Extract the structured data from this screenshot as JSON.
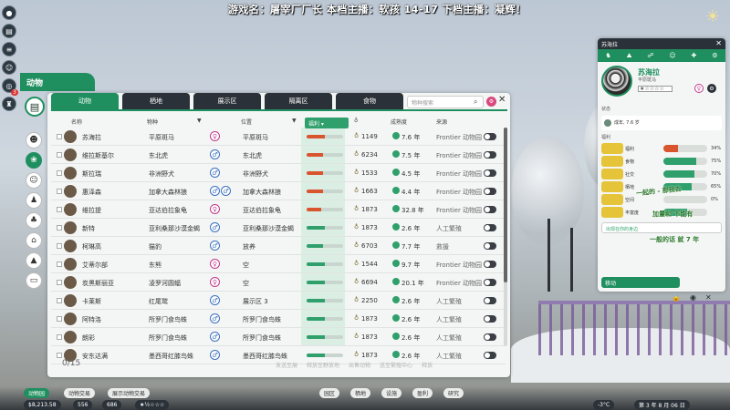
{
  "stream_title": "游戏名：屠宰厂厂长   本档主播：软孩  14-17  下档主播：凝辉！",
  "rail": {
    "badge": "3"
  },
  "window": {
    "title": "动物",
    "tabs": [
      "动物",
      "栖地",
      "展示区",
      "隔离区",
      "食物"
    ],
    "active_tab": "动物",
    "search_placeholder": "物种搜索",
    "columns": {
      "name": "名称",
      "species": "物种",
      "sex": "",
      "location": "位置",
      "welfare": "福利",
      "value": "",
      "age": "成熟度",
      "origin": "来源"
    },
    "rows": [
      {
        "name": "苏海拉",
        "species": "平原斑马",
        "sex": "f",
        "sex2": false,
        "loc": "平原斑马",
        "bar": 0.5,
        "bar_low": true,
        "num": "1149",
        "age": "7.6 年",
        "src": "Frontier 动物园"
      },
      {
        "name": "维拉斯基尔",
        "species": "东北虎",
        "sex": "m",
        "sex2": false,
        "loc": "东北虎",
        "bar": 0.45,
        "bar_low": true,
        "num": "6234",
        "age": "7.5 年",
        "src": "Frontier 动物园"
      },
      {
        "name": "斯拉瑞",
        "species": "非洲野犬",
        "sex": "m",
        "sex2": false,
        "loc": "非洲野犬",
        "bar": 0.45,
        "bar_low": true,
        "num": "1533",
        "age": "4.5 年",
        "src": "Frontier 动物园"
      },
      {
        "name": "惠泽森",
        "species": "加拿大森林狼",
        "sex": "m",
        "sex2": true,
        "loc": "加拿大森林狼",
        "bar": 0.45,
        "bar_low": true,
        "num": "1663",
        "age": "4.4 年",
        "src": "Frontier 动物园"
      },
      {
        "name": "维拉提",
        "species": "亚达伯拉象龟",
        "sex": "f",
        "sex2": false,
        "loc": "亚达伯拉象龟",
        "bar": 0.4,
        "bar_low": true,
        "num": "1873",
        "age": "32.8 年",
        "src": "Frontier 动物园"
      },
      {
        "name": "新特",
        "species": "亚利桑那沙漠金蝎",
        "sex": "m",
        "sex2": false,
        "loc": "亚利桑那沙漠金蝎",
        "bar": 0.5,
        "bar_low": false,
        "num": "1873",
        "age": "2.6 年",
        "src": "人工繁殖"
      },
      {
        "name": "柯琳高",
        "species": "猫豹",
        "sex": "m",
        "sex2": false,
        "loc": "放养",
        "bar": 0.45,
        "bar_low": false,
        "num": "6703",
        "age": "7.7 年",
        "src": "救援"
      },
      {
        "name": "艾蒂尔部",
        "species": "东熊",
        "sex": "f",
        "sex2": false,
        "loc": "空",
        "bar": 0.5,
        "bar_low": false,
        "num": "1544",
        "age": "9.7 年",
        "src": "Frontier 动物园"
      },
      {
        "name": "炭黑斯丽亚",
        "species": "凌罗河圆蝠",
        "sex": "f",
        "sex2": false,
        "loc": "空",
        "bar": 0.5,
        "bar_low": false,
        "num": "6694",
        "age": "20.1 年",
        "src": "Frontier 动物园"
      },
      {
        "name": "卡莱斯",
        "species": "红尾鹫",
        "sex": "m",
        "sex2": false,
        "loc": "展示区 3",
        "bar": 0.5,
        "bar_low": false,
        "num": "2250",
        "age": "2.6 年",
        "src": "人工繁殖"
      },
      {
        "name": "阿特洛",
        "species": "所罗门食鸟蛛",
        "sex": "m",
        "sex2": false,
        "loc": "所罗门食鸟蛛",
        "bar": 0.5,
        "bar_low": false,
        "num": "1873",
        "age": "2.6 年",
        "src": "人工繁殖"
      },
      {
        "name": "朗彩",
        "species": "所罗门食鸟蛛",
        "sex": "m",
        "sex2": false,
        "loc": "所罗门食鸟蛛",
        "bar": 0.5,
        "bar_low": false,
        "num": "1873",
        "age": "2.6 年",
        "src": "人工繁殖"
      },
      {
        "name": "安东达满",
        "species": "墨西哥红膝鸟蛛",
        "sex": "m",
        "sex2": false,
        "loc": "墨西哥红膝鸟蛛",
        "bar": 0.5,
        "bar_low": false,
        "num": "1873",
        "age": "2.6 年",
        "src": "人工繁殖"
      }
    ],
    "count": "0/15",
    "actions": [
      "发送至展",
      "释放至野放地",
      "出售动物",
      "送至繁殖中心",
      "释放"
    ]
  },
  "detail": {
    "header": "苏海拉",
    "name": "苏海拉",
    "species": "平原斑马",
    "status_label": "状态",
    "status_text": "成年, 7.6 岁",
    "welfare_label": "福利",
    "welfare": [
      {
        "label": "福利",
        "value": "34%",
        "level": 0.34,
        "kind": "low"
      },
      {
        "label": "食物",
        "value": "75%",
        "level": 0.75,
        "kind": "ok"
      },
      {
        "label": "社交",
        "value": "70%",
        "level": 0.7,
        "kind": "ok"
      },
      {
        "label": "栖地",
        "value": "65%",
        "level": 0.65,
        "kind": "ok"
      },
      {
        "label": "空间",
        "value": "0%",
        "level": 0.0,
        "kind": "red"
      },
      {
        "label": "丰富度",
        "value": "",
        "level": 0.55,
        "kind": "ok"
      }
    ],
    "overlay_texts": [
      "一起的 - 那我去",
      "加量和 不能有",
      "一般的话 就 7 年"
    ],
    "ship_text": "出现在你的身边",
    "move_label": "移动"
  },
  "bottom": {
    "money": "$8,213.58",
    "items": [
      "动物园",
      "动物交易",
      "展示动物交易",
      "园区",
      "栖地",
      "设施",
      "盈利",
      "研究",
      "温度",
      "日历"
    ],
    "temp": "-3°C",
    "date": "第 3 年 8 月 06 日",
    "guests": "556",
    "staff": "686"
  }
}
